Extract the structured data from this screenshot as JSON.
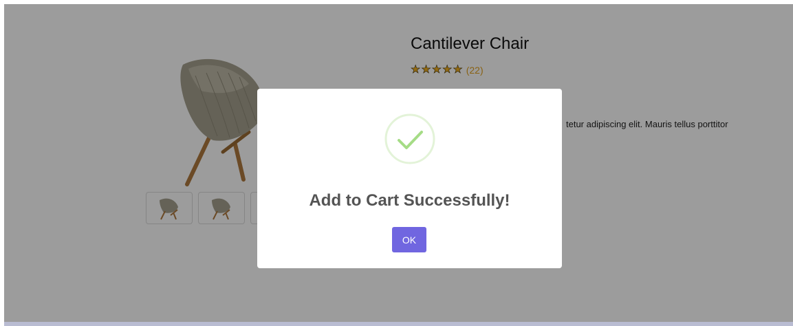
{
  "product": {
    "title": "Cantilever Chair",
    "rating": {
      "stars": [
        "★",
        "★",
        "★",
        "★",
        "★"
      ],
      "count_label": "(22)"
    },
    "description_visible": "tetur adipiscing elit. Mauris tellus porttitor"
  },
  "gallery": {
    "thumbnails": [
      "chair-thumbnail",
      "chair-thumbnail",
      "chair-thumbnail"
    ]
  },
  "modal": {
    "icon": "success-check-icon",
    "title": "Add to Cart Successfully!",
    "ok_label": "OK"
  },
  "colors": {
    "accent": "#7066e0",
    "success": "#a5dc86",
    "star": "#f2b01e",
    "overlay": "rgba(0,0,0,0.39)"
  }
}
